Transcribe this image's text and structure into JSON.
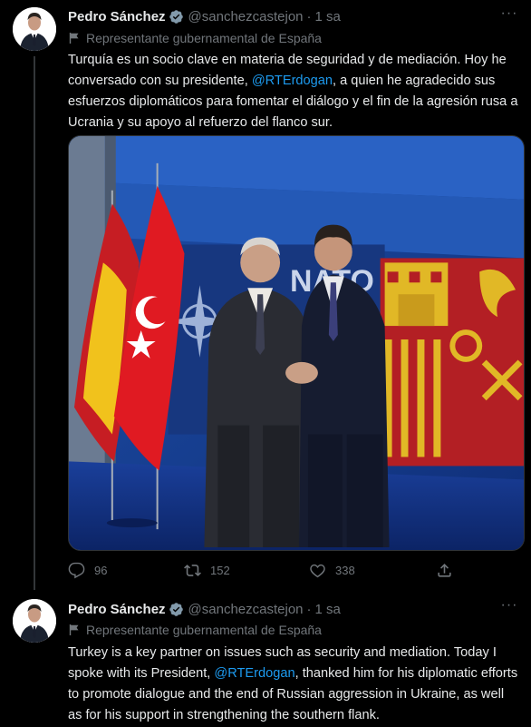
{
  "tweets": [
    {
      "author": {
        "name": "Pedro Sánchez",
        "handle": "@sanchezcastejon",
        "time": "1 sa"
      },
      "label": "Representante gubernamental de España",
      "text_parts": [
        "Turquía es un socio clave en materia de seguridad y de mediación. Hoy he conversado con su presidente, ",
        "@RTErdogan",
        ", a quien he agradecido sus esfuerzos diplomáticos para fomentar el diálogo y el fin de la agresión rusa a Ucrania y su apoyo al refuerzo del flanco sur."
      ],
      "photo": {
        "backdrop_text": "NATO"
      },
      "stats": {
        "replies": "96",
        "retweets": "152",
        "likes": "338"
      }
    },
    {
      "author": {
        "name": "Pedro Sánchez",
        "handle": "@sanchezcastejon",
        "time": "1 sa"
      },
      "label": "Representante gubernamental de España",
      "text_parts": [
        "Turkey is a key partner on issues such as security and mediation. Today I spoke with its President, ",
        "@RTErdogan",
        ", thanked him for his diplomatic efforts to promote dialogue and the end of Russian aggression in Ukraine, as well as for his support in strengthening the southern flank."
      ]
    }
  ],
  "ui": {
    "dot": "·",
    "more": "···"
  },
  "colors": {
    "background": "#000000",
    "text": "#e7e9ea",
    "muted": "#71767b",
    "accent": "#1d9bf0"
  },
  "icons": [
    "verified-badge-icon",
    "government-flag-icon",
    "more-icon",
    "reply-icon",
    "retweet-icon",
    "like-icon",
    "share-icon"
  ]
}
